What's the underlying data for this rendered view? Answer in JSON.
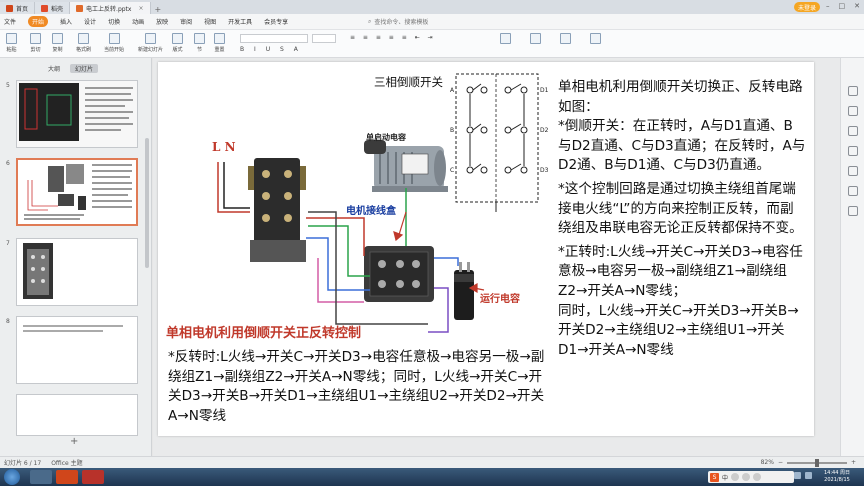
{
  "window": {
    "tabs": [
      {
        "label": "首页",
        "color": "#d0461b"
      },
      {
        "label": "稻壳",
        "color": "#e04b2a"
      },
      {
        "label": "电工上反转.pptx",
        "color": "#e06a2a"
      }
    ],
    "user_label": "未登录"
  },
  "menu": {
    "file": "文件",
    "items": [
      "开始",
      "插入",
      "设计",
      "切换",
      "动画",
      "放映",
      "审阅",
      "视图",
      "开发工具",
      "会员专享"
    ],
    "start_label": "开始",
    "search_placeholder": "查找命令、搜索模板"
  },
  "ribbon": {
    "buttons": [
      "粘贴",
      "剪切",
      "复制",
      "格式刷",
      "当前开始",
      "新建幻灯片",
      "版式",
      "节",
      "重置"
    ]
  },
  "left_panel": {
    "tabs": [
      "大纲",
      "幻灯片"
    ],
    "slide_numbers": [
      "5",
      "6",
      "7",
      "8"
    ]
  },
  "status": {
    "slide_info": "幻灯片 6 / 17",
    "theme": "Office 主题",
    "zoom": "82%"
  },
  "taskbar": {
    "time": "14:44 周日",
    "date": "2021/8/15",
    "ime": "中"
  },
  "slide": {
    "switch_title": "三相倒顺开关",
    "cap_label": "单启动电容",
    "box_label": "电机接线盒",
    "run_cap_label": "运行电容",
    "ln_label": "L N",
    "caption": "单相电机利用倒顺开关正反转控制",
    "terminal_labels": [
      "A",
      "B",
      "C",
      "D1",
      "D2",
      "D3"
    ],
    "right_text": [
      "单相电机利用倒顺开关切换正、反转电路如图：",
      "*倒顺开关：在正转时，A与D1直通、B与D2直通、C与D3直通；在反转时，A与D2通、B与D1通、C与D3仍直通。",
      "*这个控制回路是通过切换主绕组首尾端接电火线“L”的方向来控制正反转，而副绕组及串联电容无论正反转都保持不变。",
      "*正转时:L火线→开关C→开关D3→电容任意极→电容另一极→副绕组Z1→副绕组Z2→开关A→N零线；",
      "同时，L火线→开关C→开关D3→开关B→开关D2→主绕组U2→主绕组U1→开关D1→开关A→N零线"
    ],
    "bottom_text": "*反转时:L火线→开关C→开关D3→电容任意极→电容另一极→副绕组Z1→副绕组Z2→开关A→N零线；同时，L火线→开关C→开关D3→开关B→开关D1→主绕组U1→主绕组U2→开关D2→开关A→N零线"
  }
}
